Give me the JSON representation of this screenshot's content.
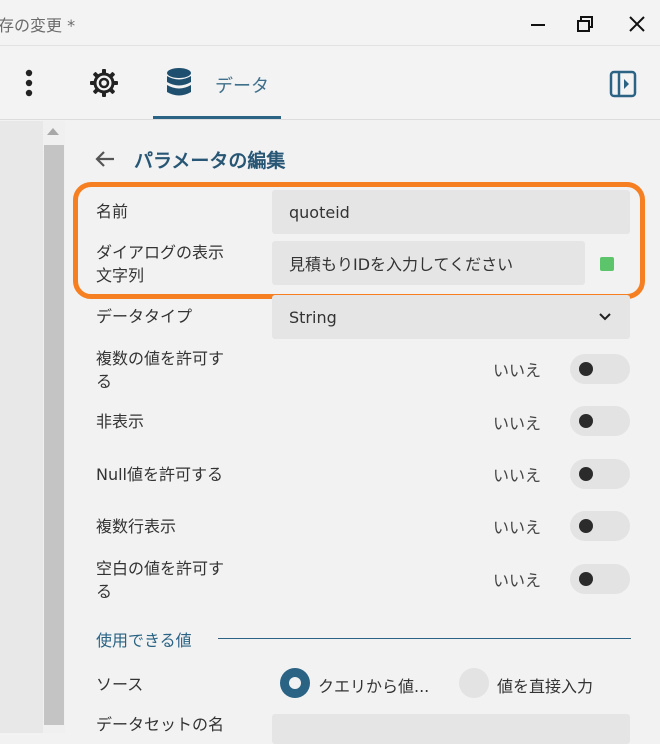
{
  "window": {
    "title": "存の変更 *",
    "minimize_icon": "minimize-icon",
    "restore_icon": "restore-icon",
    "close_icon": "close-icon"
  },
  "toolbar": {
    "more_icon": "more-vertical-icon",
    "settings_icon": "gear-icon",
    "data_tab_icon": "database-icon",
    "data_tab_label": "データ",
    "panel_toggle_icon": "panel-collapse-icon",
    "accent_color": "#2a6384"
  },
  "editor": {
    "back_icon": "arrow-left-icon",
    "title": "パラメータの編集",
    "name_label": "名前",
    "name_value": "quoteid",
    "prompt_label_line1": "ダイアログの表示",
    "prompt_label_line2": "文字列",
    "prompt_value": "見積もりIDを入力してください",
    "prompt_status_color": "#5cc46a",
    "datatype_label": "データタイプ",
    "datatype_value": "String",
    "multi_label_line1": "複数の値を許可す",
    "multi_label_line2": "る",
    "multi_value": "いいえ",
    "hidden_label": "非表示",
    "hidden_value": "いいえ",
    "null_label": "Null値を許可する",
    "null_value": "いいえ",
    "multiline_label": "複数行表示",
    "multiline_value": "いいえ",
    "blank_label_line1": "空白の値を許可す",
    "blank_label_line2": "る",
    "blank_value": "いいえ",
    "available_values_section": "使用できる値",
    "source_label": "ソース",
    "source_option_query": "クエリから値...",
    "source_option_direct": "値を直接入力",
    "dataset_label": "データセットの名",
    "highlight_color": "#f57f21"
  }
}
